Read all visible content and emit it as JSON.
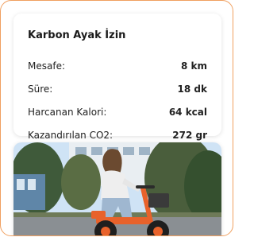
{
  "card": {
    "title": "Karbon Ayak İzin",
    "rows": [
      {
        "label": "Mesafe:",
        "value": "8 km"
      },
      {
        "label": "Süre:",
        "value": "18 dk"
      },
      {
        "label": "Harcanan Kalori:",
        "value": "64 kcal"
      },
      {
        "label": "Kazandırılan CO2:",
        "value": "272 gr"
      }
    ]
  },
  "colors": {
    "accent": "#f0a060",
    "scooter_orange": "#e8622b",
    "sky": "#cfe3f5"
  },
  "image": {
    "subject": "woman-on-orange-electric-scooter"
  }
}
